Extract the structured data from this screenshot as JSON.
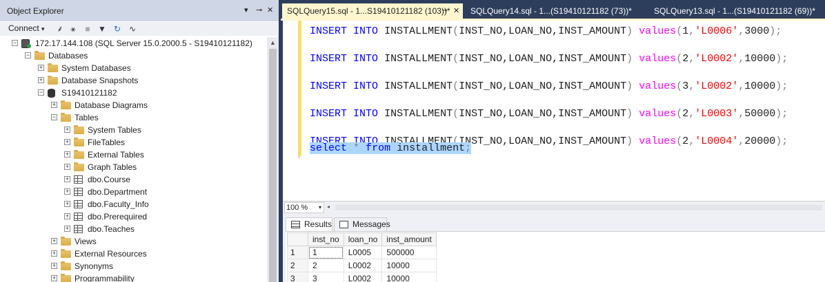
{
  "object_explorer": {
    "title": "Object Explorer",
    "connect_label": "Connect",
    "tree": [
      {
        "id": "server",
        "label": "172.17.144.108 (SQL Server 15.0.2000.5 - S19410121182)",
        "icon": "server-icon",
        "expanded": true,
        "level": 0
      },
      {
        "id": "databases",
        "label": "Databases",
        "icon": "folder-icon",
        "expanded": true,
        "level": 1
      },
      {
        "id": "system-databases",
        "label": "System Databases",
        "icon": "folder-icon",
        "expanded": false,
        "level": 2
      },
      {
        "id": "database-snapshots",
        "label": "Database Snapshots",
        "icon": "folder-icon",
        "expanded": false,
        "level": 2
      },
      {
        "id": "db-s19410121182",
        "label": "S19410121182",
        "icon": "database-icon",
        "expanded": true,
        "level": 2
      },
      {
        "id": "database-diagrams",
        "label": "Database Diagrams",
        "icon": "folder-icon",
        "expanded": false,
        "level": 3
      },
      {
        "id": "tables",
        "label": "Tables",
        "icon": "folder-icon",
        "expanded": true,
        "level": 3
      },
      {
        "id": "system-tables",
        "label": "System Tables",
        "icon": "folder-icon",
        "expanded": false,
        "level": 4
      },
      {
        "id": "filetables",
        "label": "FileTables",
        "icon": "folder-icon",
        "expanded": false,
        "level": 4
      },
      {
        "id": "external-tables",
        "label": "External Tables",
        "icon": "folder-icon",
        "expanded": false,
        "level": 4
      },
      {
        "id": "graph-tables",
        "label": "Graph Tables",
        "icon": "folder-icon",
        "expanded": false,
        "level": 4
      },
      {
        "id": "dbo-course",
        "label": "dbo.Course",
        "icon": "table-icon",
        "expanded": false,
        "level": 4
      },
      {
        "id": "dbo-department",
        "label": "dbo.Department",
        "icon": "table-icon",
        "expanded": false,
        "level": 4
      },
      {
        "id": "dbo-faculty-info",
        "label": "dbo.Faculty_Info",
        "icon": "table-icon",
        "expanded": false,
        "level": 4
      },
      {
        "id": "dbo-prerequired",
        "label": "dbo.Prerequired",
        "icon": "table-icon",
        "expanded": false,
        "level": 4
      },
      {
        "id": "dbo-teaches",
        "label": "dbo.Teaches",
        "icon": "table-icon",
        "expanded": false,
        "level": 4
      },
      {
        "id": "views",
        "label": "Views",
        "icon": "folder-icon",
        "expanded": false,
        "level": 3
      },
      {
        "id": "external-resources",
        "label": "External Resources",
        "icon": "folder-icon",
        "expanded": false,
        "level": 3
      },
      {
        "id": "synonyms",
        "label": "Synonyms",
        "icon": "folder-icon",
        "expanded": false,
        "level": 3
      },
      {
        "id": "programmability",
        "label": "Programmability",
        "icon": "folder-icon",
        "expanded": false,
        "level": 3
      }
    ]
  },
  "tabs": [
    {
      "label": "SQLQuery15.sql - 1...S19410121182 (103))*",
      "active": true
    },
    {
      "label": "SQLQuery14.sql - 1...(S19410121182 (73))*",
      "active": false
    },
    {
      "label": "SQLQuery13.sql - 1...(S19410121182 (69))*",
      "active": false
    }
  ],
  "editor": {
    "lines": [
      {
        "kw1": "INSERT",
        "kw2": "INTO",
        "table": "INSTALLMENT",
        "cols": "INST_NO,LOAN_NO,INST_AMOUNT",
        "fn": "values",
        "n1": "1",
        "str": "'L0006'",
        "n2": "3000"
      },
      {
        "kw1": "INSERT",
        "kw2": "INTO",
        "table": "INSTALLMENT",
        "cols": "INST_NO,LOAN_NO,INST_AMOUNT",
        "fn": "values",
        "n1": "2",
        "str": "'L0002'",
        "n2": "10000"
      },
      {
        "kw1": "INSERT",
        "kw2": "INTO",
        "table": "INSTALLMENT",
        "cols": "INST_NO,LOAN_NO,INST_AMOUNT",
        "fn": "values",
        "n1": "3",
        "str": "'L0002'",
        "n2": "10000"
      },
      {
        "kw1": "INSERT",
        "kw2": "INTO",
        "table": "INSTALLMENT",
        "cols": "INST_NO,LOAN_NO,INST_AMOUNT",
        "fn": "values",
        "n1": "2",
        "str": "'L0003'",
        "n2": "50000"
      },
      {
        "kw1": "INSERT",
        "kw2": "INTO",
        "table": "INSTALLMENT",
        "cols": "INST_NO,LOAN_NO,INST_AMOUNT",
        "fn": "values",
        "n1": "2",
        "str": "'L0004'",
        "n2": "20000"
      }
    ],
    "select_line": {
      "kw1": "select",
      "star": "*",
      "kw2": "from",
      "table": "installment",
      "end": ";"
    }
  },
  "zoom": {
    "value": "100 %"
  },
  "results": {
    "tab_results": "Results",
    "tab_messages": "Messages",
    "columns": [
      "inst_no",
      "loan_no",
      "inst_amount"
    ],
    "rows": [
      {
        "num": "1",
        "cells": [
          "1",
          "L0005",
          "500000"
        ]
      },
      {
        "num": "2",
        "cells": [
          "2",
          "L0002",
          "10000"
        ]
      },
      {
        "num": "3",
        "cells": [
          "3",
          "L0002",
          "10000"
        ]
      }
    ]
  },
  "colors": {
    "titlebar": "#2d3e5c",
    "active_tab": "#fff6cf",
    "selection": "#add6ff",
    "keyword": "#0000ff",
    "string": "#ff0000",
    "function": "#ff00ff"
  }
}
